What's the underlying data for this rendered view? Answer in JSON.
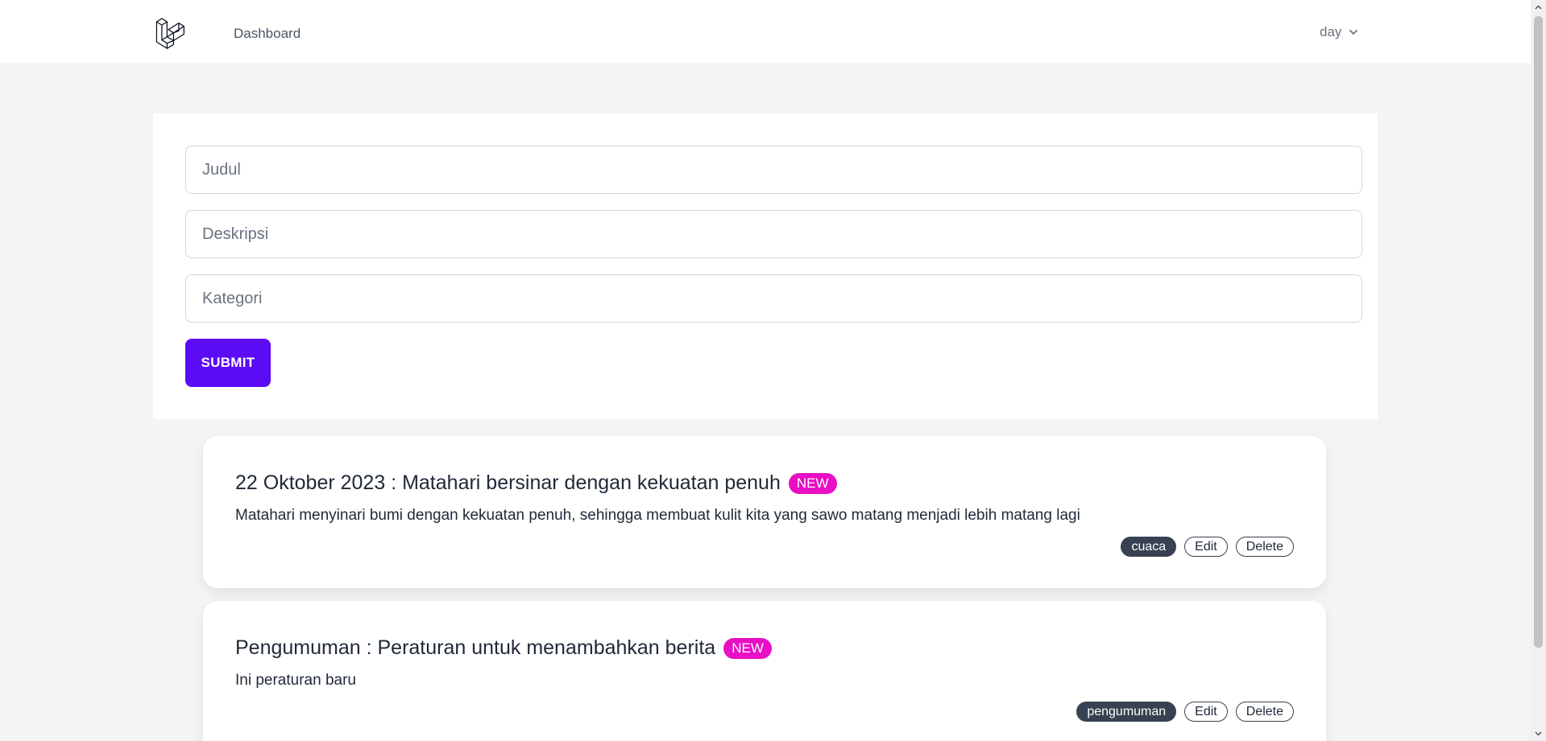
{
  "nav": {
    "logo_icon": "laravel-logo-icon",
    "links": [
      "Dashboard"
    ],
    "user_name": "day",
    "user_menu_icon": "chevron-down-icon"
  },
  "form": {
    "title_placeholder": "Judul",
    "description_placeholder": "Deskripsi",
    "category_placeholder": "Kategori",
    "submit_label": "SUBMIT",
    "submit_color": "#5b0cf5"
  },
  "news": [
    {
      "title": "22 Oktober 2023 : Matahari bersinar dengan kekuatan penuh",
      "badge": "NEW",
      "description": "Matahari menyinari bumi dengan kekuatan penuh, sehingga membuat kulit kita yang sawo matang menjadi lebih matang lagi",
      "category": "cuaca",
      "edit_label": "Edit",
      "delete_label": "Delete"
    },
    {
      "title": "Pengumuman : Peraturan untuk menambahkan berita",
      "badge": "NEW",
      "description": "Ini peraturan baru",
      "category": "pengumuman",
      "edit_label": "Edit",
      "delete_label": "Delete"
    }
  ],
  "colors": {
    "badge_new": "#e80fc4",
    "category_chip": "#374151",
    "page_background": "#f3f4f6"
  }
}
